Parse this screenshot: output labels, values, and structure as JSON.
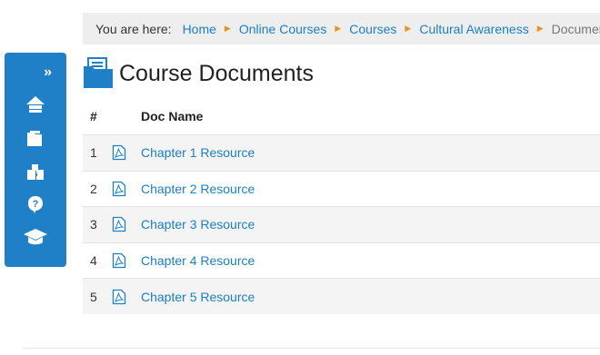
{
  "breadcrumb": {
    "label": "You are here:",
    "items": [
      {
        "text": "Home"
      },
      {
        "text": "Online Courses"
      },
      {
        "text": "Courses"
      },
      {
        "text": "Cultural Awareness"
      }
    ],
    "current": "Documents"
  },
  "sidebar": {
    "expand_label": "»",
    "items": [
      {
        "icon": "home-icon"
      },
      {
        "icon": "folder-icon"
      },
      {
        "icon": "puzzle-icon"
      },
      {
        "icon": "help-icon"
      },
      {
        "icon": "graduation-cap-icon"
      }
    ]
  },
  "page": {
    "title": "Course Documents",
    "title_icon": "folder-icon"
  },
  "table": {
    "headers": {
      "num": "#",
      "name": "Doc Name"
    },
    "rows": [
      {
        "num": "1",
        "name": "Chapter 1 Resource",
        "icon": "pdf-icon"
      },
      {
        "num": "2",
        "name": "Chapter 2 Resource",
        "icon": "pdf-icon"
      },
      {
        "num": "3",
        "name": "Chapter 3 Resource",
        "icon": "pdf-icon"
      },
      {
        "num": "4",
        "name": "Chapter 4 Resource",
        "icon": "pdf-icon"
      },
      {
        "num": "5",
        "name": "Chapter 5 Resource",
        "icon": "pdf-icon"
      }
    ]
  },
  "colors": {
    "accent": "#1f7fc7",
    "link": "#1b7fc4",
    "separator": "#e8931e"
  }
}
